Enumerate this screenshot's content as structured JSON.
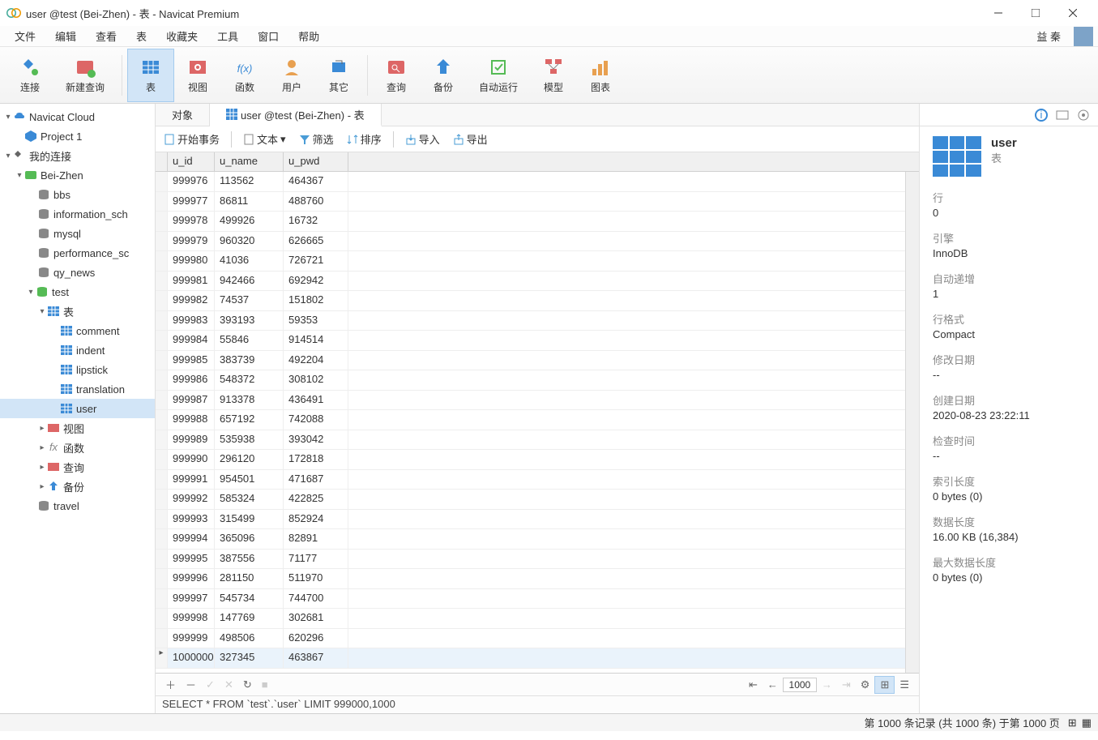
{
  "title": "user @test (Bei-Zhen) - 表 - Navicat Premium",
  "menu": [
    "文件",
    "编辑",
    "查看",
    "表",
    "收藏夹",
    "工具",
    "窗口",
    "帮助"
  ],
  "user_label": "益 秦",
  "toolbar": [
    {
      "label": "连接",
      "icon": "plug"
    },
    {
      "label": "新建查询",
      "icon": "newquery"
    },
    {
      "label": "表",
      "icon": "table",
      "active": true
    },
    {
      "label": "视图",
      "icon": "view"
    },
    {
      "label": "函数",
      "icon": "fx"
    },
    {
      "label": "用户",
      "icon": "user"
    },
    {
      "label": "其它",
      "icon": "other"
    },
    {
      "label": "查询",
      "icon": "query"
    },
    {
      "label": "备份",
      "icon": "backup"
    },
    {
      "label": "自动运行",
      "icon": "auto"
    },
    {
      "label": "模型",
      "icon": "model"
    },
    {
      "label": "图表",
      "icon": "chart"
    }
  ],
  "sidebar": {
    "cloud": "Navicat Cloud",
    "project": "Project 1",
    "myconn": "我的连接",
    "conn": "Bei-Zhen",
    "dbs": [
      "bbs",
      "information_sch",
      "mysql",
      "performance_sc",
      "qy_news"
    ],
    "testdb": "test",
    "tables_label": "表",
    "tables": [
      "comment",
      "indent",
      "lipstick",
      "translation",
      "user"
    ],
    "others": [
      "视图",
      "函数",
      "查询",
      "备份"
    ],
    "travel": "travel"
  },
  "tabs": {
    "objects": "对象",
    "current": "user @test (Bei-Zhen) - 表"
  },
  "toolrow": {
    "begin": "开始事务",
    "text": "文本",
    "filter": "筛选",
    "sort": "排序",
    "import": "导入",
    "export": "导出"
  },
  "columns": [
    "u_id",
    "u_name",
    "u_pwd"
  ],
  "rows": [
    [
      "999976",
      "113562",
      "464367"
    ],
    [
      "999977",
      "86811",
      "488760"
    ],
    [
      "999978",
      "499926",
      "16732"
    ],
    [
      "999979",
      "960320",
      "626665"
    ],
    [
      "999980",
      "41036",
      "726721"
    ],
    [
      "999981",
      "942466",
      "692942"
    ],
    [
      "999982",
      "74537",
      "151802"
    ],
    [
      "999983",
      "393193",
      "59353"
    ],
    [
      "999984",
      "55846",
      "914514"
    ],
    [
      "999985",
      "383739",
      "492204"
    ],
    [
      "999986",
      "548372",
      "308102"
    ],
    [
      "999987",
      "913378",
      "436491"
    ],
    [
      "999988",
      "657192",
      "742088"
    ],
    [
      "999989",
      "535938",
      "393042"
    ],
    [
      "999990",
      "296120",
      "172818"
    ],
    [
      "999991",
      "954501",
      "471687"
    ],
    [
      "999992",
      "585324",
      "422825"
    ],
    [
      "999993",
      "315499",
      "852924"
    ],
    [
      "999994",
      "365096",
      "82891"
    ],
    [
      "999995",
      "387556",
      "71177"
    ],
    [
      "999996",
      "281150",
      "511970"
    ],
    [
      "999997",
      "545734",
      "744700"
    ],
    [
      "999998",
      "147769",
      "302681"
    ],
    [
      "999999",
      "498506",
      "620296"
    ],
    [
      "1000000",
      "327345",
      "463867"
    ]
  ],
  "sql": "SELECT * FROM `test`.`user` LIMIT 999000,1000",
  "status": "第 1000 条记录 (共 1000 条) 于第 1000 页",
  "page": "1000",
  "props": {
    "name": "user",
    "type": "表",
    "rows_l": "行",
    "rows_v": "0",
    "engine_l": "引擎",
    "engine_v": "InnoDB",
    "auto_l": "自动递增",
    "auto_v": "1",
    "fmt_l": "行格式",
    "fmt_v": "Compact",
    "mod_l": "修改日期",
    "mod_v": "--",
    "cre_l": "创建日期",
    "cre_v": "2020-08-23 23:22:11",
    "chk_l": "检查时间",
    "chk_v": "--",
    "idx_l": "索引长度",
    "idx_v": "0 bytes (0)",
    "dat_l": "数据长度",
    "dat_v": "16.00 KB (16,384)",
    "max_l": "最大数据长度",
    "max_v": "0 bytes (0)"
  }
}
